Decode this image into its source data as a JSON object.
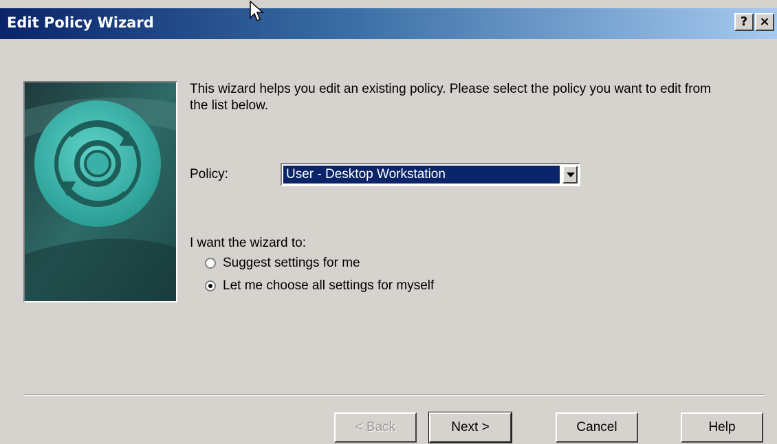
{
  "window": {
    "title": "Edit Policy Wizard",
    "help_glyph": "?",
    "close_glyph": "×"
  },
  "intro_text": "This wizard helps you edit an existing policy.  Please select the policy you want to edit from the list below.",
  "policy": {
    "label": "Policy:",
    "selected_value": "User - Desktop Workstation"
  },
  "wizard_mode": {
    "label": "I want the wizard to:",
    "options": [
      {
        "label": "Suggest settings for me",
        "checked": false
      },
      {
        "label": "Let me choose all settings for myself",
        "checked": true
      }
    ]
  },
  "buttons": {
    "back": "< Back",
    "next": "Next >",
    "cancel": "Cancel",
    "help": "Help"
  },
  "colors": {
    "title_bar_start": "#0a246a",
    "title_bar_end": "#a6caf0",
    "dialog_bg": "#d6d3ce",
    "selection_bg": "#0a246a",
    "image_accent": "#3ab0a6"
  },
  "icons": [
    "mouse-cursor-icon",
    "help-icon",
    "close-icon",
    "dropdown-arrow-icon",
    "policy-refresh-icon"
  ]
}
